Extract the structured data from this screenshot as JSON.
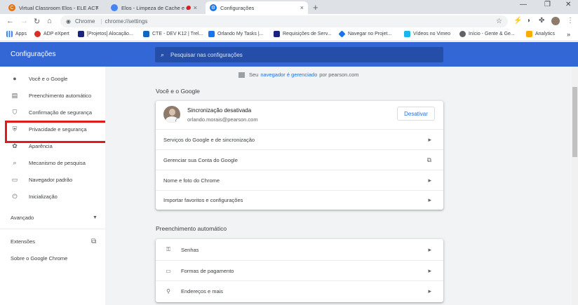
{
  "tabs": [
    {
      "label": "Virtual Classroom Elos - ELE ACT",
      "color": "#e8710a"
    },
    {
      "label": "Elos - Limpeza de Cache e C",
      "color": "#4285f4"
    },
    {
      "label": "Configurações",
      "color": "#1a73e8"
    }
  ],
  "omnibox": {
    "site": "Chrome",
    "url": "chrome://settings"
  },
  "bookmarks": [
    {
      "label": "Apps",
      "color": "#4285f4"
    },
    {
      "label": "ADP eXpert",
      "color": "#d93025"
    },
    {
      "label": "[Projetos] Alocação...",
      "color": "#1a237e"
    },
    {
      "label": "CTE - DEV K12 | Trel...",
      "color": "#1565c0"
    },
    {
      "label": "Orlando My Tasks |...",
      "color": "#1a73e8"
    },
    {
      "label": "Requisições de Serv...",
      "color": "#1a237e"
    },
    {
      "label": "Navegar no Projet...",
      "color": "#1a73e8"
    },
    {
      "label": "Vídeos no Vimeo",
      "color": "#19b7ea"
    },
    {
      "label": "Início - Gente & Ge...",
      "color": "#5f6368"
    },
    {
      "label": "Analytics",
      "color": "#f9ab00"
    }
  ],
  "header": {
    "title": "Configurações",
    "search_placeholder": "Pesquisar nas configurações"
  },
  "sidebar": {
    "items": [
      {
        "label": "Você e o Google",
        "icon": "person-icon"
      },
      {
        "label": "Preenchimento automático",
        "icon": "autofill-icon"
      },
      {
        "label": "Confirmação de segurança",
        "icon": "shield-check-icon"
      },
      {
        "label": "Privacidade e segurança",
        "icon": "shield-icon"
      },
      {
        "label": "Aparência",
        "icon": "palette-icon"
      },
      {
        "label": "Mecanismo de pesquisa",
        "icon": "search-icon"
      },
      {
        "label": "Navegador padrão",
        "icon": "browser-icon"
      },
      {
        "label": "Inicialização",
        "icon": "power-icon"
      }
    ],
    "advanced": "Avançado",
    "extensions": "Extensões",
    "about": "Sobre o Google Chrome"
  },
  "managed": {
    "prefix": "Seu",
    "link": "navegador é gerenciado",
    "suffix": "por pearson.com"
  },
  "you_google": {
    "title": "Você e o Google",
    "sync_title": "Sincronização desativada",
    "email": "orlando.morais@pearson.com",
    "button": "Desativar",
    "rows": [
      "Serviços do Google e de sincronização",
      "Gerenciar sua Conta do Google",
      "Nome e foto do Chrome",
      "Importar favoritos e configurações"
    ]
  },
  "autofill": {
    "title": "Preenchimento automático",
    "rows": [
      "Senhas",
      "Formas de pagamento",
      "Endereços e mais"
    ]
  },
  "colors": {
    "header": "#3367d6",
    "highlight": "#e01b1b",
    "link": "#1a73e8"
  }
}
